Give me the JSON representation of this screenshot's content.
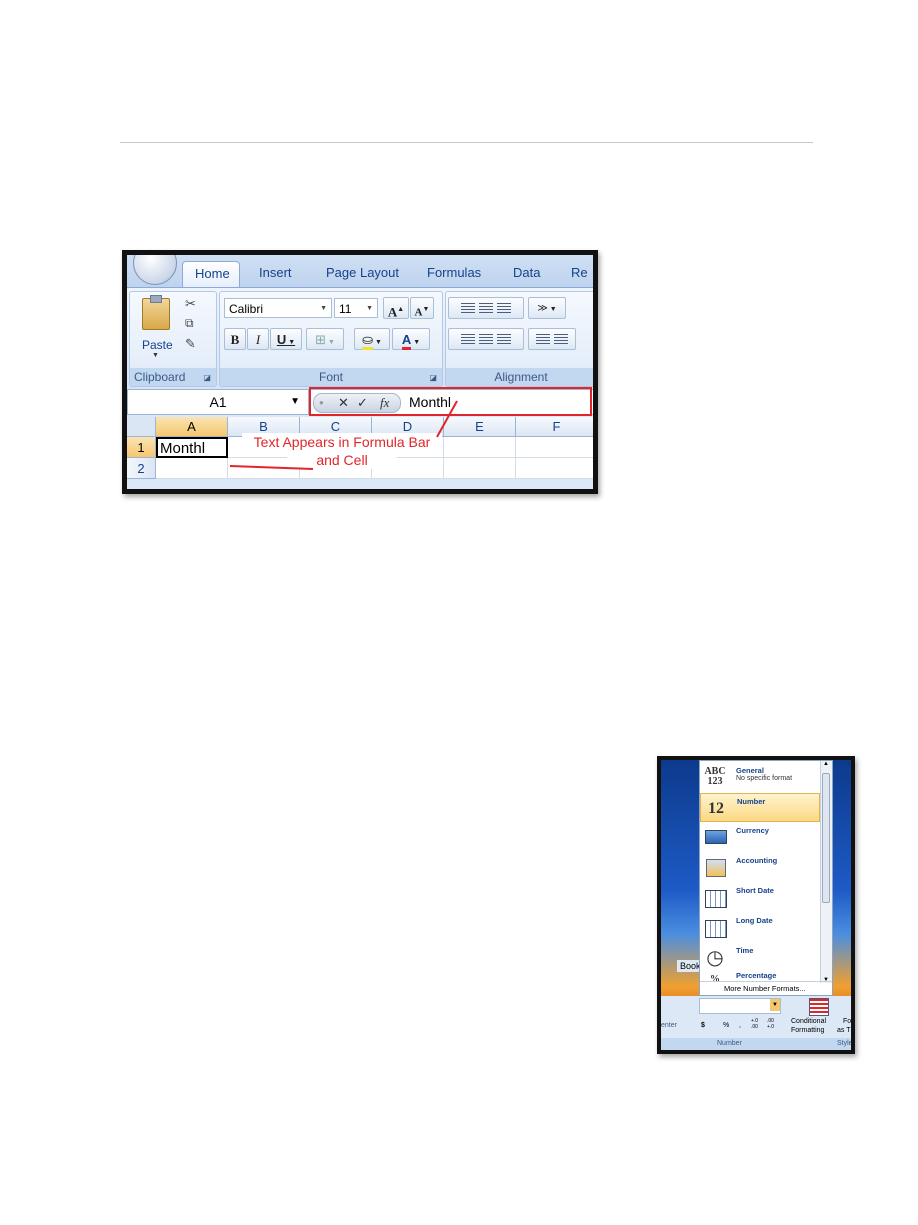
{
  "excel": {
    "tabs": [
      "Home",
      "Insert",
      "Page Layout",
      "Formulas",
      "Data",
      "Re"
    ],
    "clipboard": {
      "paste_label": "Paste",
      "group_label": "Clipboard"
    },
    "font": {
      "name": "Calibri",
      "size": "11",
      "bold": "B",
      "italic": "I",
      "underline": "U",
      "grow": "A",
      "shrink": "A",
      "group_label": "Font"
    },
    "alignment": {
      "group_label": "Alignment"
    },
    "name_box": "A1",
    "formula_value": "Monthl",
    "fx": "fx",
    "columns": [
      "A",
      "B",
      "C",
      "D",
      "E",
      "F"
    ],
    "rows": [
      "1",
      "2"
    ],
    "cell_a1": "Monthl",
    "annotation_line1": "Text Appears in Formula Bar",
    "annotation_line2": "and Cell",
    "colors": {
      "callout": "#e0262a",
      "ribbon_text": "#15428b"
    }
  },
  "number_menu": {
    "items": [
      {
        "icon": "ABC 123",
        "label": "General",
        "sub": "No specific format"
      },
      {
        "icon": "12",
        "label": "Number",
        "sub": ""
      },
      {
        "icon": "currency-icon",
        "label": "Currency",
        "sub": ""
      },
      {
        "icon": "accounting-icon",
        "label": "Accounting",
        "sub": ""
      },
      {
        "icon": "calendar-icon",
        "label": "Short Date",
        "sub": ""
      },
      {
        "icon": "calendar-icon",
        "label": "Long Date",
        "sub": ""
      },
      {
        "icon": "clock-icon",
        "label": "Time",
        "sub": ""
      },
      {
        "icon": "percent-icon",
        "label": "Percentage",
        "sub": ""
      }
    ],
    "more": "More Number Formats...",
    "book_tab": "Book",
    "center_label": "enter",
    "cond_format_1": "Conditional",
    "cond_format_2": "Formatting",
    "format_as": "Fo",
    "format_as_2": "as T",
    "number_group": "Number",
    "style_group": "Style",
    "currency_symbol": "$",
    "percent_symbol": "%",
    "comma_symbol": ",",
    "inc_decimal": "+.0 .00",
    "dec_decimal": ".00 +.0"
  }
}
